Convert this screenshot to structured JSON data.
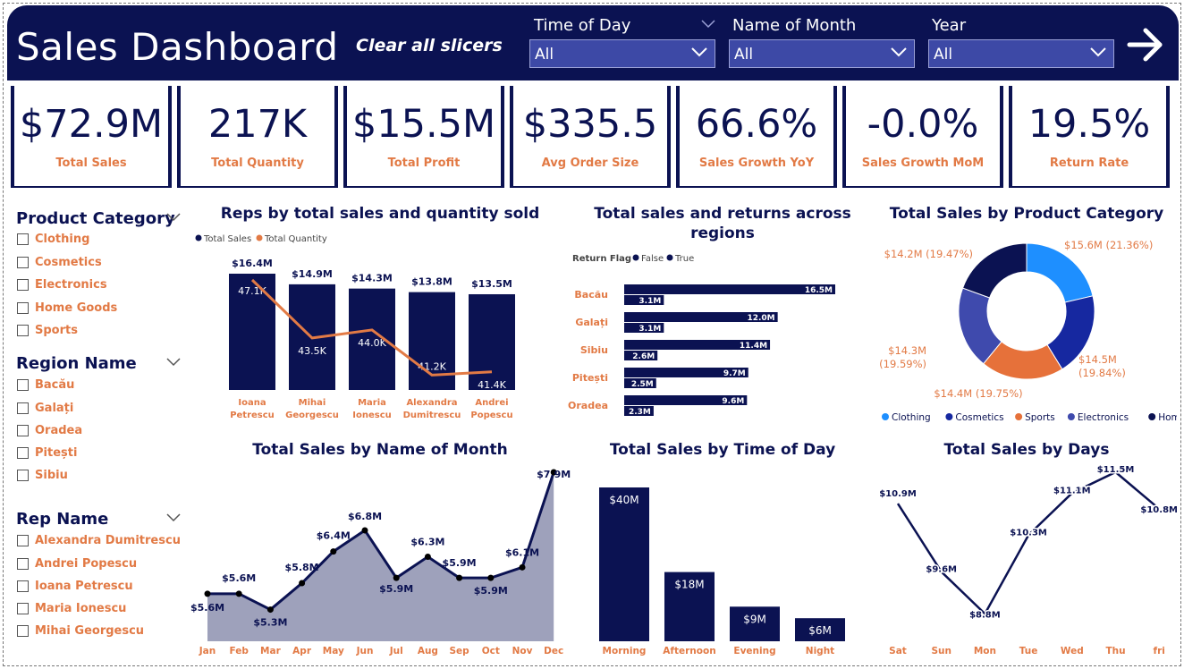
{
  "header": {
    "title": "Sales Dashboard",
    "clear_label": "Clear all slicers",
    "slicers": [
      {
        "label": "Time of Day",
        "value": "All"
      },
      {
        "label": "Name of Month",
        "value": "All"
      },
      {
        "label": "Year",
        "value": "All"
      }
    ]
  },
  "kpis": [
    {
      "value": "$72.9M",
      "label": "Total Sales"
    },
    {
      "value": "217K",
      "label": "Total Quantity"
    },
    {
      "value": "$15.5M",
      "label": "Total Profit"
    },
    {
      "value": "$335.5",
      "label": "Avg Order Size"
    },
    {
      "value": "66.6%",
      "label": "Sales Growth YoY"
    },
    {
      "value": "-0.0%",
      "label": "Sales Growth MoM"
    },
    {
      "value": "19.5%",
      "label": "Return Rate"
    }
  ],
  "filters": {
    "product_category": {
      "title": "Product Category",
      "items": [
        "Clothing",
        "Cosmetics",
        "Electronics",
        "Home Goods",
        "Sports"
      ]
    },
    "region": {
      "title": "Region Name",
      "items": [
        "Bacău",
        "Galați",
        "Oradea",
        "Pitești",
        "Sibiu"
      ]
    },
    "rep": {
      "title": "Rep Name",
      "items": [
        "Alexandra Dumitrescu",
        "Andrei Popescu",
        "Ioana Petrescu",
        "Maria Ionescu",
        "Mihai Georgescu"
      ]
    }
  },
  "colors": {
    "navy": "#0b1252",
    "orange": "#e27a45",
    "slicer": "#3d49a6"
  },
  "chart_data": [
    {
      "id": "reps",
      "type": "bar",
      "title": "Reps by total sales and quantity sold",
      "legend": [
        "Total Sales",
        "Total Quantity"
      ],
      "categories": [
        [
          "Ioana",
          "Petrescu"
        ],
        [
          "Mihai",
          "Georgescu"
        ],
        [
          "Maria",
          "Ionescu"
        ],
        [
          "Alexandra",
          "Dumitrescu"
        ],
        [
          "Andrei",
          "Popescu"
        ]
      ],
      "series": [
        {
          "name": "Total Sales",
          "values": [
            16.4,
            14.9,
            14.3,
            13.8,
            13.5
          ],
          "labels": [
            "$16.4M",
            "$14.9M",
            "$14.3M",
            "$13.8M",
            "$13.5M"
          ]
        },
        {
          "name": "Total Quantity",
          "values": [
            47.1,
            43.5,
            44.0,
            41.2,
            41.4
          ],
          "labels": [
            "47.1K",
            "43.5K",
            "44.0K",
            "41.2K",
            "41.4K"
          ]
        }
      ]
    },
    {
      "id": "regions",
      "type": "bar",
      "title": "Total sales and returns across regions",
      "legend_title": "Return Flag",
      "legend": [
        "False",
        "True"
      ],
      "categories": [
        "Bacău",
        "Galați",
        "Sibiu",
        "Pitești",
        "Oradea"
      ],
      "series": [
        {
          "name": "False",
          "values": [
            16.5,
            12.0,
            11.4,
            9.7,
            9.6
          ],
          "labels": [
            "16.5M",
            "12.0M",
            "11.4M",
            "9.7M",
            "9.6M"
          ]
        },
        {
          "name": "True",
          "values": [
            3.1,
            3.1,
            2.6,
            2.5,
            2.3
          ],
          "labels": [
            "3.1M",
            "3.1M",
            "2.6M",
            "2.5M",
            "2.3M"
          ]
        }
      ]
    },
    {
      "id": "category",
      "type": "pie",
      "title": "Total Sales by Product Category",
      "slices": [
        {
          "name": "Clothing",
          "value": 15.6,
          "label": "$15.6M (21.36%)",
          "color": "#1e8fff"
        },
        {
          "name": "Cosmetics",
          "value": 14.5,
          "label": "$14.5M (19.84%)",
          "color": "#1628a0"
        },
        {
          "name": "Sports",
          "value": 14.4,
          "label": "$14.4M (19.75%)",
          "color": "#e6713a"
        },
        {
          "name": "Electronics",
          "value": 14.3,
          "label": "$14.3M (19.59%)",
          "color": "#3f4aad"
        },
        {
          "name": "Home Goods",
          "value": 14.2,
          "label": "$14.2M (19.47%)",
          "color": "#0b1252"
        }
      ]
    },
    {
      "id": "month",
      "type": "area",
      "title": "Total Sales by Name of Month",
      "categories": [
        "Jan",
        "Feb",
        "Mar",
        "Apr",
        "May",
        "Jun",
        "Jul",
        "Aug",
        "Sep",
        "Oct",
        "Nov",
        "Dec"
      ],
      "values": [
        5.6,
        5.6,
        5.3,
        5.8,
        6.4,
        6.8,
        5.9,
        6.3,
        5.9,
        5.9,
        6.1,
        7.9
      ],
      "labels": [
        "$5.6M",
        "$5.6M",
        "$5.3M",
        "$5.8M",
        "$6.4M",
        "$6.8M",
        "$5.9M",
        "$6.3M",
        "$5.9M",
        "$5.9M",
        "$6.1M",
        "$7.9M"
      ]
    },
    {
      "id": "timeofday",
      "type": "bar",
      "title": "Total Sales by Time of Day",
      "categories": [
        "Morning",
        "Afternoon",
        "Evening",
        "Night"
      ],
      "values": [
        40,
        18,
        9,
        6
      ],
      "labels": [
        "$40M",
        "$18M",
        "$9M",
        "$6M"
      ]
    },
    {
      "id": "days",
      "type": "line",
      "title": "Total Sales by Days",
      "categories": [
        "Sat",
        "Sun",
        "Mon",
        "Tue",
        "Wed",
        "Thu",
        "fri"
      ],
      "values": [
        10.9,
        9.6,
        8.8,
        10.3,
        11.1,
        11.5,
        10.8
      ],
      "labels": [
        "$10.9M",
        "$9.6M",
        "$8.8M",
        "$10.3M",
        "$11.1M",
        "$11.5M",
        "$10.8M"
      ]
    }
  ]
}
